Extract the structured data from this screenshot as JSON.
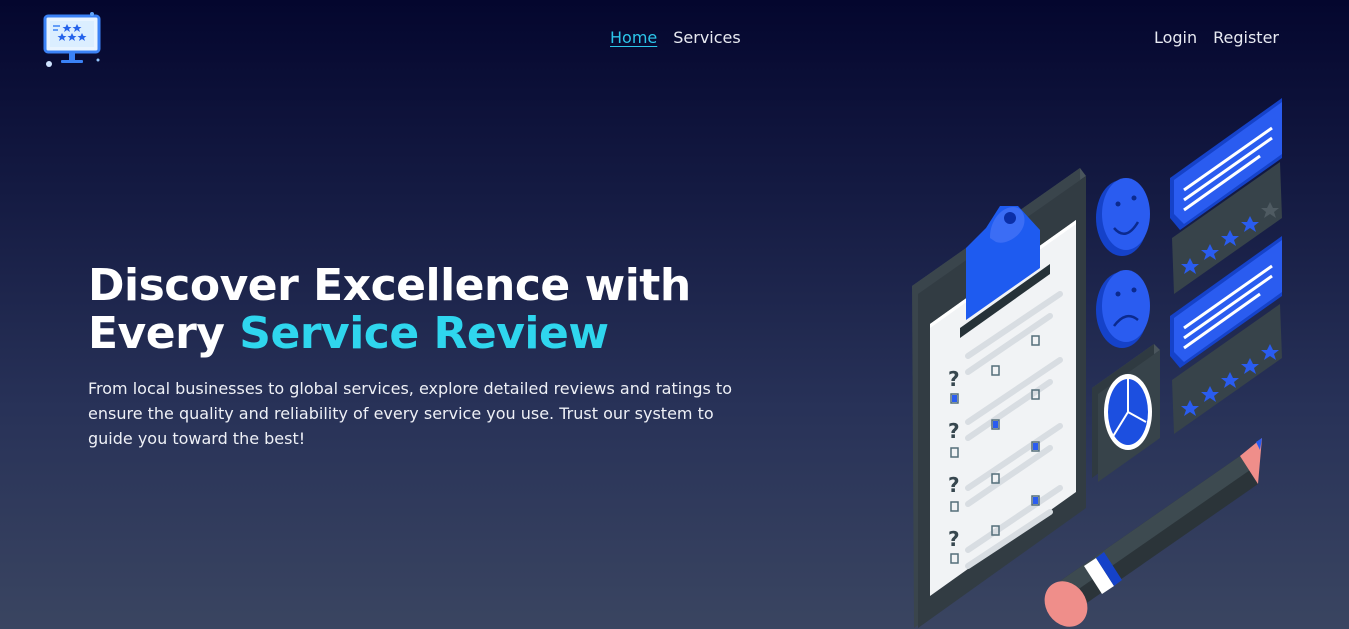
{
  "nav": {
    "logo_icon": "monitor-stars-logo",
    "links": [
      {
        "label": "Home",
        "active": true
      },
      {
        "label": "Services",
        "active": false
      }
    ],
    "auth": {
      "login": "Login",
      "register": "Register"
    }
  },
  "hero": {
    "title_line1": "Discover Excellence with",
    "title_line2_plain": "Every ",
    "title_line2_accent": "Service Review",
    "description": "From local businesses to global services, explore detailed reviews and ratings to ensure the quality and reliability of every service you use. Trust our system to guide you toward the best!"
  },
  "illustration": {
    "icon": "review-clipboard-illustration",
    "questionnaire_marks": [
      "?",
      "?",
      "?",
      "?"
    ]
  },
  "colors": {
    "accent": "#2fd6ee",
    "link_active": "#2cc6ea",
    "illustration_blue": "#2a5cf0",
    "background_top": "#04062e",
    "background_bottom": "#3a4561"
  }
}
